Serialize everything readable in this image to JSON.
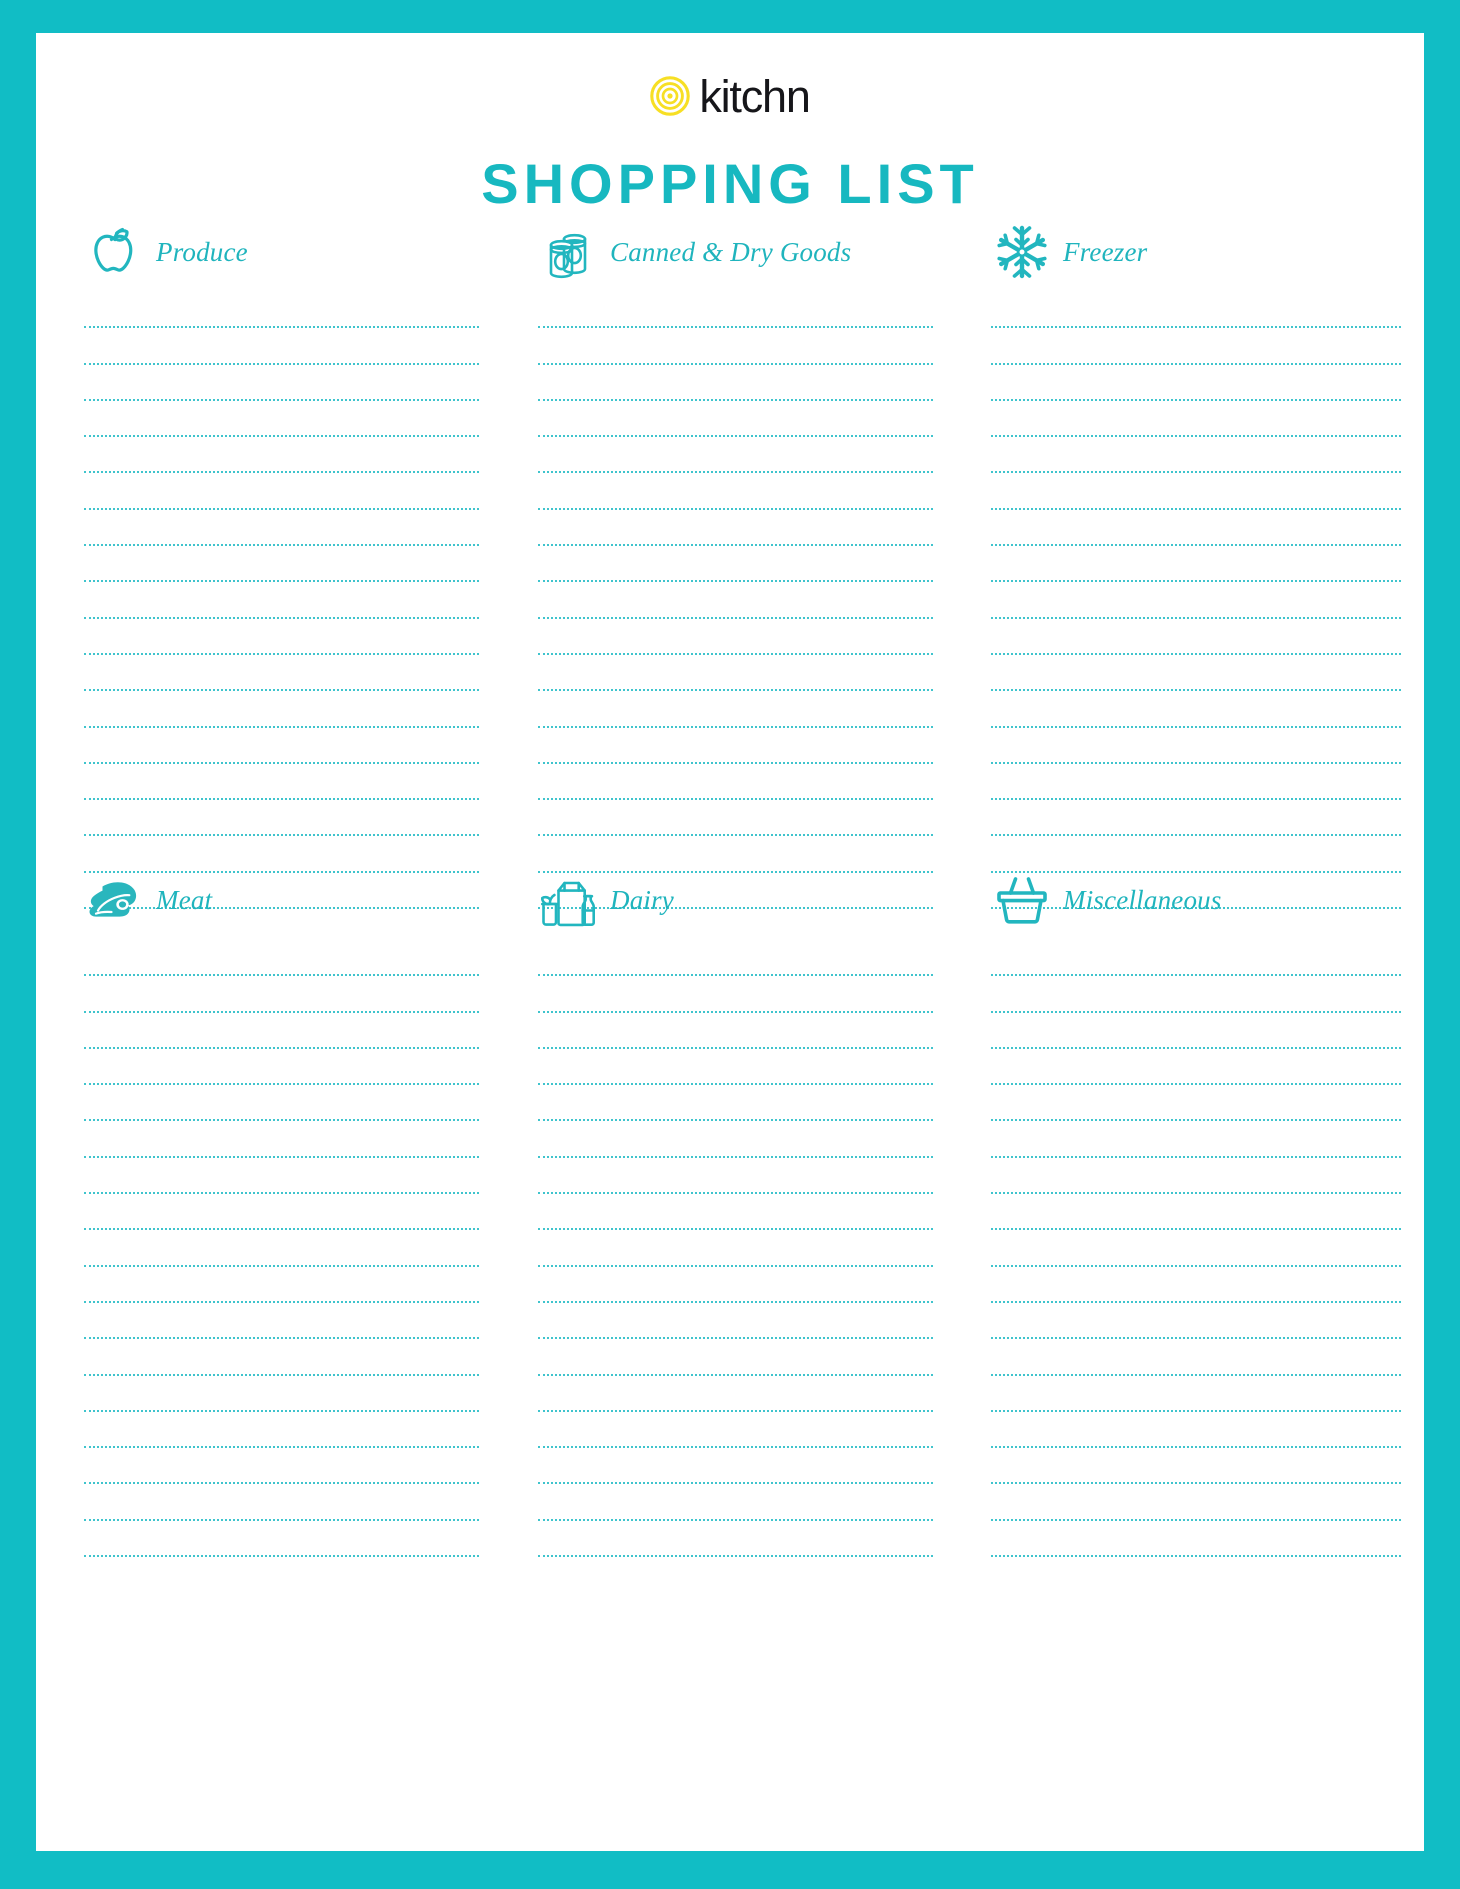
{
  "document": {
    "title": "SHOPPING LIST",
    "brand_name": "kitchn",
    "brand_mark_icon": "kitchn-spiral-logo-icon",
    "accent_color": "#11bdc5",
    "title_color": "#17b8c0",
    "label_color": "#1fb4bd",
    "line_color": "#3fc4cd",
    "brand_mark_color": "#f7df24",
    "brand_word_color": "#16161a",
    "page_background": "#ffffff",
    "border_color": "#11bdc5"
  },
  "categories": [
    {
      "id": "produce",
      "label": "Produce",
      "icon": "apple-icon",
      "line_count": 17,
      "column": 1,
      "row": 1
    },
    {
      "id": "canned-and-dry-goods",
      "label": "Canned & Dry Goods",
      "icon": "cans-icon",
      "line_count": 17,
      "column": 2,
      "row": 1
    },
    {
      "id": "freezer",
      "label": "Freezer",
      "icon": "snowflake-icon",
      "line_count": 17,
      "column": 3,
      "row": 1
    },
    {
      "id": "meat",
      "label": "Meat",
      "icon": "steak-icon",
      "line_count": 17,
      "column": 1,
      "row": 2
    },
    {
      "id": "dairy",
      "label": "Dairy",
      "icon": "milk-carton-and-bottle-icon",
      "line_count": 17,
      "column": 2,
      "row": 2
    },
    {
      "id": "miscellaneous",
      "label": "Miscellaneous",
      "icon": "shopping-basket-icon",
      "line_count": 17,
      "column": 3,
      "row": 2
    }
  ]
}
